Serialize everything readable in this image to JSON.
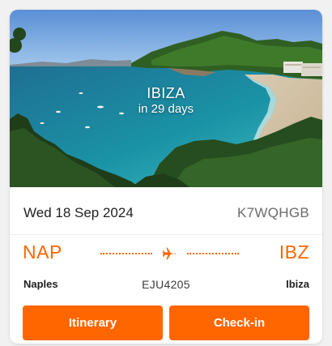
{
  "hero": {
    "destination": "IBIZA",
    "countdown": "in 29 days"
  },
  "flight": {
    "date": "Wed 18 Sep 2024",
    "booking_ref": "K7WQHGB",
    "origin_code": "NAP",
    "destination_code": "IBZ",
    "origin_city": "Naples",
    "destination_city": "Ibiza",
    "flight_number": "EJU4205"
  },
  "actions": {
    "itinerary_label": "Itinerary",
    "checkin_label": "Check-in"
  },
  "icons": {
    "route": "airplane-icon"
  },
  "colors": {
    "brand": "#ff6600",
    "text": "#1f1f1f",
    "muted": "#6b6b6b"
  }
}
